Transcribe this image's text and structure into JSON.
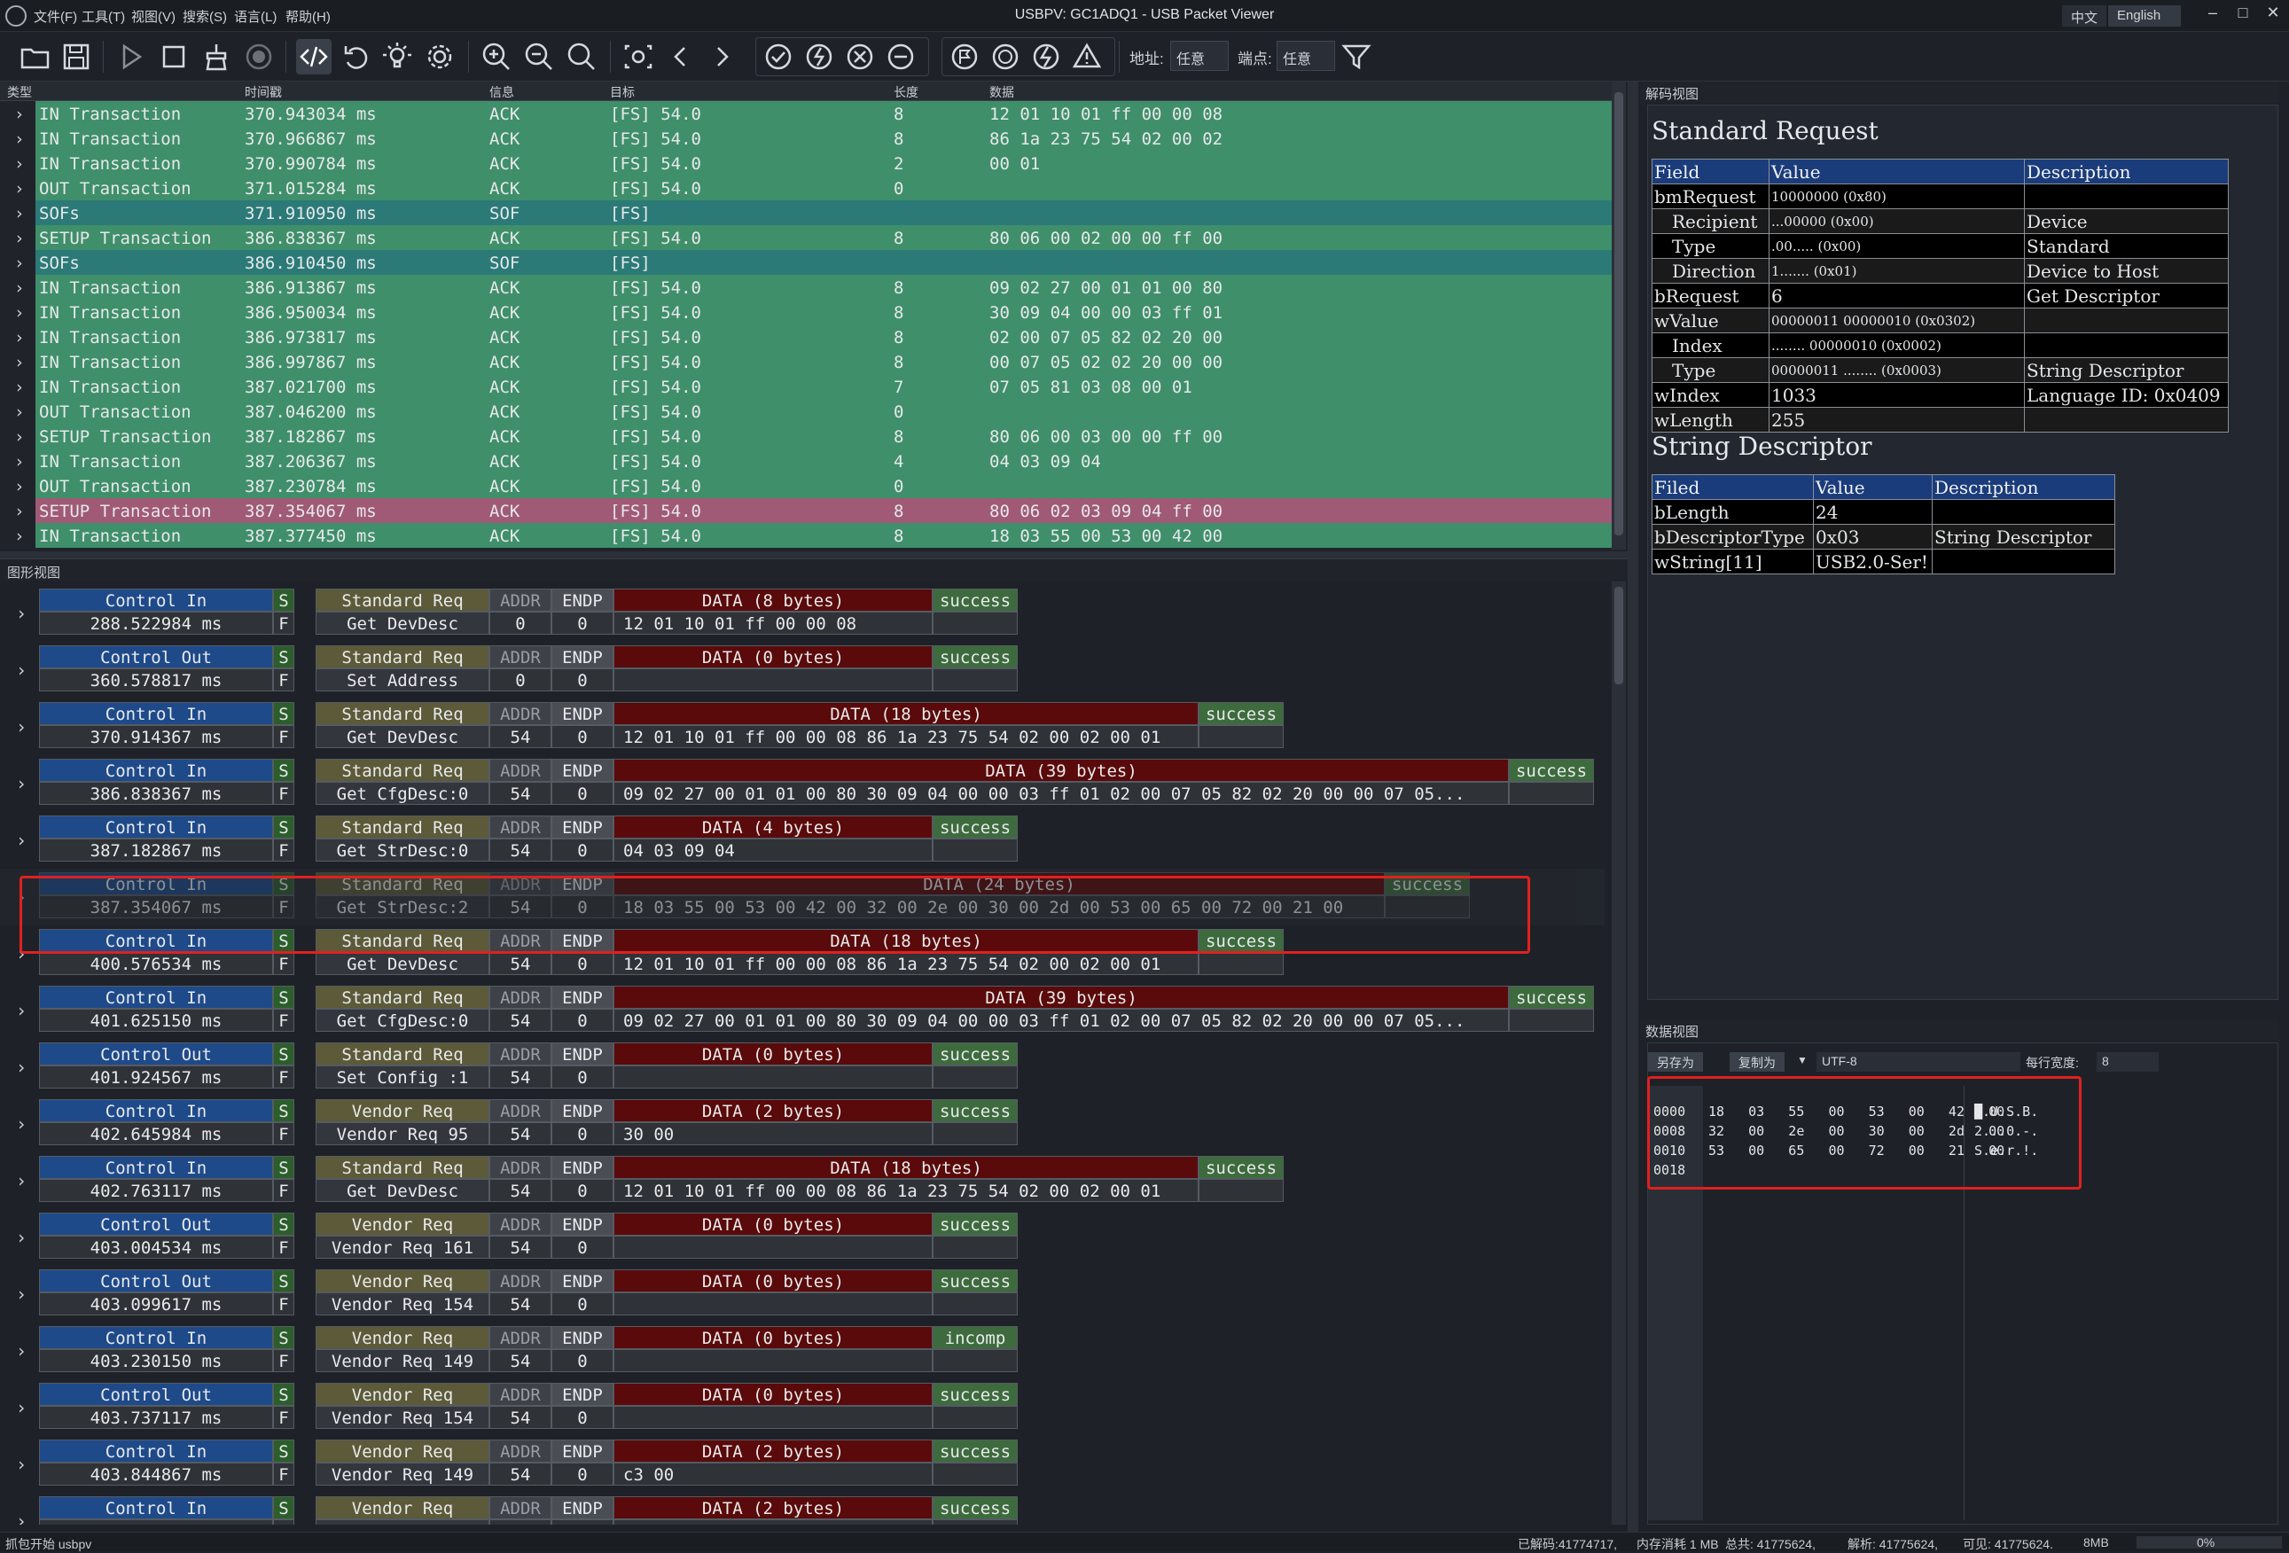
{
  "window": {
    "title": "USBPV: GC1ADQ1 - USB Packet Viewer",
    "menus": [
      "文件(F)",
      "工具(T)",
      "视图(V)",
      "搜索(S)",
      "语言(L)",
      "帮助(H)"
    ],
    "lang_zh": "中文",
    "lang_en": "English",
    "min": "–",
    "max": "□",
    "close": "✕"
  },
  "toolbar": {
    "icons": [
      "open-folder",
      "save",
      "play",
      "stop",
      "clear",
      "record",
      "code",
      "undo",
      "light",
      "settings",
      "zoom-in",
      "zoom-out",
      "zoom-fit",
      "view",
      "prev",
      "next",
      "filter-ack",
      "filter-nak",
      "filter-stall",
      "filter-nyet",
      "filter-sof",
      "filter-sof2",
      "filter-error",
      "filter-warning",
      "funnel"
    ],
    "addr_label": "地址:",
    "addr_value": "任意",
    "endp_label": "端点:",
    "endp_value": "任意"
  },
  "list": {
    "columns": [
      "类型",
      "时间戳",
      "信息",
      "目标",
      "长度",
      "数据"
    ],
    "rows": [
      {
        "type": "IN Transaction",
        "time": "370.943034 ms",
        "info": "ACK",
        "target": "[FS] 54.0",
        "len": "8",
        "data": "12 01 10 01 ff 00 00 08",
        "kind": "green"
      },
      {
        "type": "IN Transaction",
        "time": "370.966867 ms",
        "info": "ACK",
        "target": "[FS] 54.0",
        "len": "8",
        "data": "86 1a 23 75 54 02 00 02",
        "kind": "green"
      },
      {
        "type": "IN Transaction",
        "time": "370.990784 ms",
        "info": "ACK",
        "target": "[FS] 54.0",
        "len": "2",
        "data": "00 01",
        "kind": "green"
      },
      {
        "type": "OUT Transaction",
        "time": "371.015284 ms",
        "info": "ACK",
        "target": "[FS] 54.0",
        "len": "0",
        "data": "",
        "kind": "green"
      },
      {
        "type": "SOFs",
        "time": "371.910950 ms",
        "info": "SOF",
        "target": "[FS]",
        "len": "",
        "data": "",
        "kind": "teal"
      },
      {
        "type": "SETUP Transaction",
        "time": "386.838367 ms",
        "info": "ACK",
        "target": "[FS] 54.0",
        "len": "8",
        "data": "80 06 00 02 00 00 ff 00",
        "kind": "green"
      },
      {
        "type": "SOFs",
        "time": "386.910450 ms",
        "info": "SOF",
        "target": "[FS]",
        "len": "",
        "data": "",
        "kind": "teal"
      },
      {
        "type": "IN Transaction",
        "time": "386.913867 ms",
        "info": "ACK",
        "target": "[FS] 54.0",
        "len": "8",
        "data": "09 02 27 00 01 01 00 80",
        "kind": "green"
      },
      {
        "type": "IN Transaction",
        "time": "386.950034 ms",
        "info": "ACK",
        "target": "[FS] 54.0",
        "len": "8",
        "data": "30 09 04 00 00 03 ff 01",
        "kind": "green"
      },
      {
        "type": "IN Transaction",
        "time": "386.973817 ms",
        "info": "ACK",
        "target": "[FS] 54.0",
        "len": "8",
        "data": "02 00 07 05 82 02 20 00",
        "kind": "green"
      },
      {
        "type": "IN Transaction",
        "time": "386.997867 ms",
        "info": "ACK",
        "target": "[FS] 54.0",
        "len": "8",
        "data": "00 07 05 02 02 20 00 00",
        "kind": "green"
      },
      {
        "type": "IN Transaction",
        "time": "387.021700 ms",
        "info": "ACK",
        "target": "[FS] 54.0",
        "len": "7",
        "data": "07 05 81 03 08 00 01",
        "kind": "green"
      },
      {
        "type": "OUT Transaction",
        "time": "387.046200 ms",
        "info": "ACK",
        "target": "[FS] 54.0",
        "len": "0",
        "data": "",
        "kind": "green"
      },
      {
        "type": "SETUP Transaction",
        "time": "387.182867 ms",
        "info": "ACK",
        "target": "[FS] 54.0",
        "len": "8",
        "data": "80 06 00 03 00 00 ff 00",
        "kind": "green"
      },
      {
        "type": "IN Transaction",
        "time": "387.206367 ms",
        "info": "ACK",
        "target": "[FS] 54.0",
        "len": "4",
        "data": "04 03 09 04",
        "kind": "green"
      },
      {
        "type": "OUT Transaction",
        "time": "387.230784 ms",
        "info": "ACK",
        "target": "[FS] 54.0",
        "len": "0",
        "data": "",
        "kind": "green"
      },
      {
        "type": "SETUP Transaction",
        "time": "387.354067 ms",
        "info": "ACK",
        "target": "[FS] 54.0",
        "len": "8",
        "data": "80 06 02 03 09 04 ff 00",
        "kind": "pink"
      },
      {
        "type": "IN Transaction",
        "time": "387.377450 ms",
        "info": "ACK",
        "target": "[FS] 54.0",
        "len": "8",
        "data": "18 03 55 00 53 00 42 00",
        "kind": "green"
      }
    ]
  },
  "graph": {
    "label": "图形视图",
    "rows": [
      {
        "dir": "Control In",
        "time": "288.522984 ms",
        "req": "Standard Req",
        "name": "Get DevDesc",
        "addr": "0",
        "endp": "0",
        "dlabel": "DATA (8 bytes)",
        "data": "12 01 10 01 ff 00 00 08",
        "status": "success",
        "w": 1,
        "dim": false
      },
      {
        "dir": "Control Out",
        "time": "360.578817 ms",
        "req": "Standard Req",
        "name": "Set Address",
        "addr": "0",
        "endp": "0",
        "dlabel": "DATA (0 bytes)",
        "data": "",
        "status": "success",
        "w": 1,
        "dim": false
      },
      {
        "dir": "Control In",
        "time": "370.914367 ms",
        "req": "Standard Req",
        "name": "Get DevDesc",
        "addr": "54",
        "endp": "0",
        "dlabel": "DATA (18 bytes)",
        "data": "12 01 10 01 ff 00 00 08 86 1a 23 75 54 02 00 02 00 01",
        "status": "success",
        "w": 2,
        "dim": false
      },
      {
        "dir": "Control In",
        "time": "386.838367 ms",
        "req": "Standard Req",
        "name": "Get CfgDesc:0",
        "addr": "54",
        "endp": "0",
        "dlabel": "DATA (39 bytes)",
        "data": "09 02 27 00 01 01 00 80 30 09 04 00 00 03 ff 01 02 00 07 05 82 02 20 00 00 07 05...",
        "status": "success",
        "w": 4,
        "dim": false
      },
      {
        "dir": "Control In",
        "time": "387.182867 ms",
        "req": "Standard Req",
        "name": "Get StrDesc:0",
        "addr": "54",
        "endp": "0",
        "dlabel": "DATA (4 bytes)",
        "data": "04 03 09 04",
        "status": "success",
        "w": 1,
        "dim": false
      },
      {
        "dir": "Control In",
        "time": "387.354067 ms",
        "req": "Standard Req",
        "name": "Get StrDesc:2",
        "addr": "54",
        "endp": "0",
        "dlabel": "DATA (24 bytes)",
        "data": "18 03 55 00 53 00 42 00 32 00 2e 00 30 00 2d 00 53 00 65 00 72 00 21 00",
        "status": "success",
        "w": 3,
        "dim": true
      },
      {
        "dir": "Control In",
        "time": "400.576534 ms",
        "req": "Standard Req",
        "name": "Get DevDesc",
        "addr": "54",
        "endp": "0",
        "dlabel": "DATA (18 bytes)",
        "data": "12 01 10 01 ff 00 00 08 86 1a 23 75 54 02 00 02 00 01",
        "status": "success",
        "w": 2,
        "dim": false
      },
      {
        "dir": "Control In",
        "time": "401.625150 ms",
        "req": "Standard Req",
        "name": "Get CfgDesc:0",
        "addr": "54",
        "endp": "0",
        "dlabel": "DATA (39 bytes)",
        "data": "09 02 27 00 01 01 00 80 30 09 04 00 00 03 ff 01 02 00 07 05 82 02 20 00 00 07 05...",
        "status": "success",
        "w": 4,
        "dim": false
      },
      {
        "dir": "Control Out",
        "time": "401.924567 ms",
        "req": "Standard Req",
        "name": "Set Config :1",
        "addr": "54",
        "endp": "0",
        "dlabel": "DATA (0 bytes)",
        "data": "",
        "status": "success",
        "w": 1,
        "dim": false
      },
      {
        "dir": "Control In",
        "time": "402.645984 ms",
        "req": "Vendor Req",
        "name": "Vendor Req 95",
        "addr": "54",
        "endp": "0",
        "dlabel": "DATA (2 bytes)",
        "data": "30 00",
        "status": "success",
        "w": 1,
        "dim": false
      },
      {
        "dir": "Control In",
        "time": "402.763117 ms",
        "req": "Standard Req",
        "name": "Get DevDesc",
        "addr": "54",
        "endp": "0",
        "dlabel": "DATA (18 bytes)",
        "data": "12 01 10 01 ff 00 00 08 86 1a 23 75 54 02 00 02 00 01",
        "status": "success",
        "w": 2,
        "dim": false
      },
      {
        "dir": "Control Out",
        "time": "403.004534 ms",
        "req": "Vendor Req",
        "name": "Vendor Req 161",
        "addr": "54",
        "endp": "0",
        "dlabel": "DATA (0 bytes)",
        "data": "",
        "status": "success",
        "w": 1,
        "dim": false
      },
      {
        "dir": "Control Out",
        "time": "403.099617 ms",
        "req": "Vendor Req",
        "name": "Vendor Req 154",
        "addr": "54",
        "endp": "0",
        "dlabel": "DATA (0 bytes)",
        "data": "",
        "status": "success",
        "w": 1,
        "dim": false
      },
      {
        "dir": "Control In",
        "time": "403.230150 ms",
        "req": "Vendor Req",
        "name": "Vendor Req 149",
        "addr": "54",
        "endp": "0",
        "dlabel": "DATA (0 bytes)",
        "data": "",
        "status": "incomp",
        "w": 1,
        "dim": false
      },
      {
        "dir": "Control Out",
        "time": "403.737117 ms",
        "req": "Vendor Req",
        "name": "Vendor Req 154",
        "addr": "54",
        "endp": "0",
        "dlabel": "DATA (0 bytes)",
        "data": "",
        "status": "success",
        "w": 1,
        "dim": false
      },
      {
        "dir": "Control In",
        "time": "403.844867 ms",
        "req": "Vendor Req",
        "name": "Vendor Req 149",
        "addr": "54",
        "endp": "0",
        "dlabel": "DATA (2 bytes)",
        "data": "c3 00",
        "status": "success",
        "w": 1,
        "dim": false
      },
      {
        "dir": "Control In",
        "time": "",
        "req": "Vendor Req",
        "name": "",
        "addr": "ADDR",
        "endp": "ENDP",
        "dlabel": "DATA (2 bytes)",
        "data": "",
        "status": "success",
        "w": 1,
        "dim": false
      }
    ],
    "s_letter": "S",
    "f_letter": "F",
    "addr_label": "ADDR",
    "endp_label": "ENDP"
  },
  "decode": {
    "panel_title": "解码视图",
    "h1": "Standard Request",
    "t1_head": [
      "Field",
      "Value",
      "Description"
    ],
    "t1_rows": [
      [
        "bmRequest",
        "10000000 (0x80)",
        ""
      ],
      [
        "Recipient",
        "...00000 (0x00)",
        "Device"
      ],
      [
        "Type",
        ".00..... (0x00)",
        "Standard"
      ],
      [
        "Direction",
        "1....... (0x01)",
        "Device to Host"
      ],
      [
        "bRequest",
        "6",
        "Get Descriptor"
      ],
      [
        "wValue",
        "00000011 00000010 (0x0302)",
        ""
      ],
      [
        "Index",
        "........ 00000010 (0x0002)",
        ""
      ],
      [
        "Type",
        "00000011 ........ (0x0003)",
        "String Descriptor"
      ],
      [
        "wIndex",
        "1033",
        "Language ID: 0x0409"
      ],
      [
        "wLength",
        "255",
        ""
      ]
    ],
    "h2": "String Descriptor",
    "t2_head": [
      "Filed",
      "Value",
      "Description"
    ],
    "t2_rows": [
      [
        "bLength",
        "24",
        ""
      ],
      [
        "bDescriptorType",
        "0x03",
        "String Descriptor"
      ],
      [
        "wString[11]",
        "USB2.0-Ser!",
        ""
      ]
    ]
  },
  "dataview": {
    "panel_title": "数据视图",
    "save_as": "另存为",
    "copy_as": "复制为",
    "encoding": "UTF-8",
    "width_label": "每行宽度:",
    "width_value": "8",
    "offsets": [
      "0000",
      "0008",
      "0010",
      "0018"
    ],
    "hex": [
      "18   03   55   00   53   00   42   00",
      "32   00   2e   00   30   00   2d   00",
      "53   00   65   00   72   00   21   00",
      ""
    ],
    "ascii": [
      "█.U.S.B.",
      "2...0.-.",
      "S.e.r.!.",
      ""
    ]
  },
  "status": {
    "left": "抓包开始 usbpv",
    "decoded": "已解码:41774717,",
    "memory": "内存消耗 1 MB",
    "total": "总共: 41775624,",
    "parsed": "解析: 41775624,",
    "visible": "可见: 41775624.",
    "mem2": "8MB",
    "percent": "0%"
  },
  "colors": {
    "green": "#3f8f6a",
    "teal": "#2b7a78",
    "pink": "#a05a76",
    "highlight": "#e02020"
  }
}
